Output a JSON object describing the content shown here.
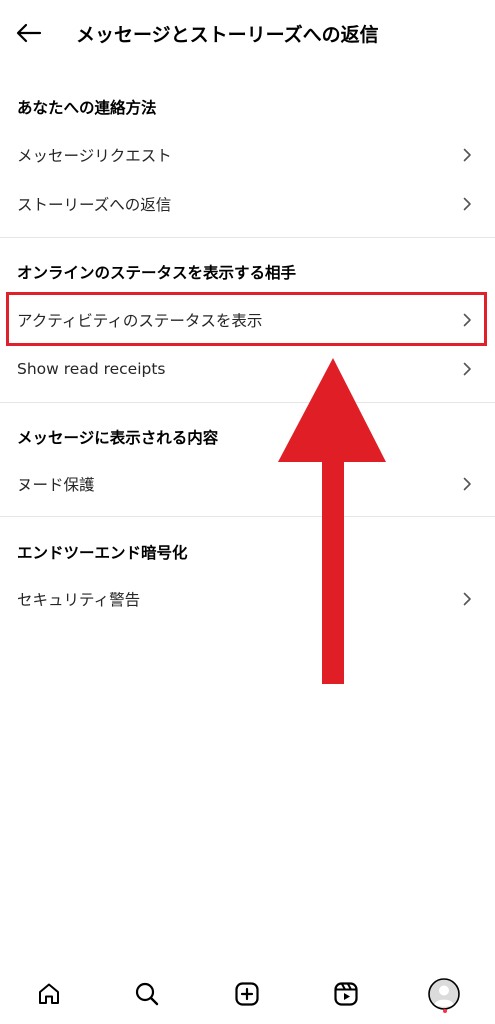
{
  "header": {
    "title": "メッセージとストーリーズへの返信"
  },
  "sections": [
    {
      "title": "あなたへの連絡方法",
      "items": [
        {
          "label": "メッセージリクエスト"
        },
        {
          "label": "ストーリーズへの返信"
        }
      ]
    },
    {
      "title": "オンラインのステータスを表示する相手",
      "items": [
        {
          "label": "アクティビティのステータスを表示"
        },
        {
          "label": "Show read receipts"
        }
      ]
    },
    {
      "title": "メッセージに表示される内容",
      "items": [
        {
          "label": "ヌード保護"
        }
      ]
    },
    {
      "title": "エンドツーエンド暗号化",
      "items": [
        {
          "label": "セキュリティ警告"
        }
      ]
    }
  ],
  "annotation": {
    "highlight_color": "#e0202a",
    "arrow_color": "#e0202a"
  },
  "bottom_nav": {
    "items": [
      {
        "icon": "home-icon"
      },
      {
        "icon": "search-icon"
      },
      {
        "icon": "create-icon"
      },
      {
        "icon": "reels-icon"
      },
      {
        "icon": "profile-avatar"
      }
    ],
    "notification_color": "#ff3040"
  }
}
